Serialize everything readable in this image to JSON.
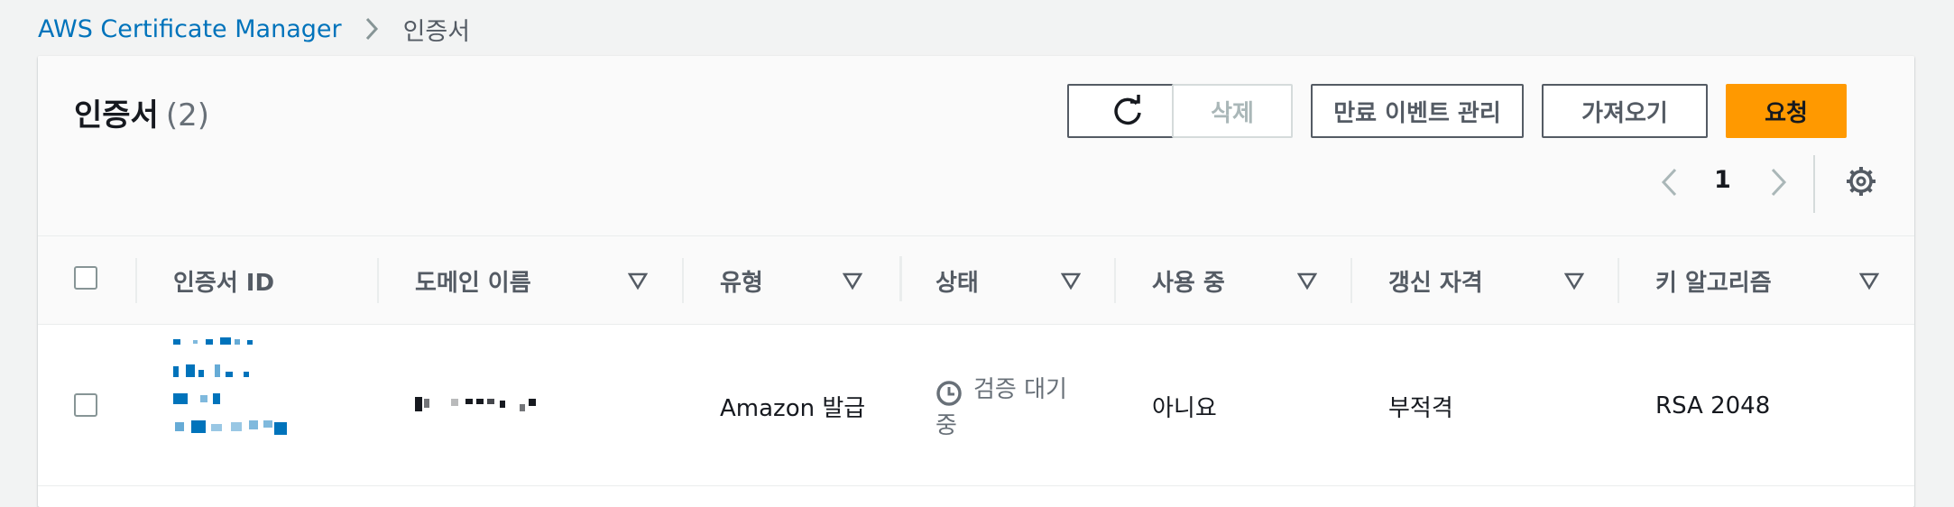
{
  "breadcrumb": {
    "root": "AWS Certificate Manager",
    "current": "인증서"
  },
  "header": {
    "title": "인증서",
    "count": "(2)"
  },
  "toolbar": {
    "refresh_icon": "refresh-icon",
    "delete_label": "삭제",
    "manage_expiry_label": "만료 이벤트 관리",
    "import_label": "가져오기",
    "request_label": "요청"
  },
  "pagination": {
    "current_page": "1"
  },
  "table": {
    "columns": [
      "인증서 ID",
      "도메인 이름",
      "유형",
      "상태",
      "사용 중",
      "갱신 자격",
      "키 알고리즘"
    ],
    "rows": [
      {
        "type": "Amazon 발급",
        "status": "검증 대기 중",
        "in_use": "아니요",
        "renewal": "부적격",
        "key_algorithm": "RSA 2048"
      }
    ]
  },
  "colors": {
    "link": "#0073bb",
    "primary": "#ff9900",
    "text": "#16191f",
    "muted": "#545b64"
  }
}
